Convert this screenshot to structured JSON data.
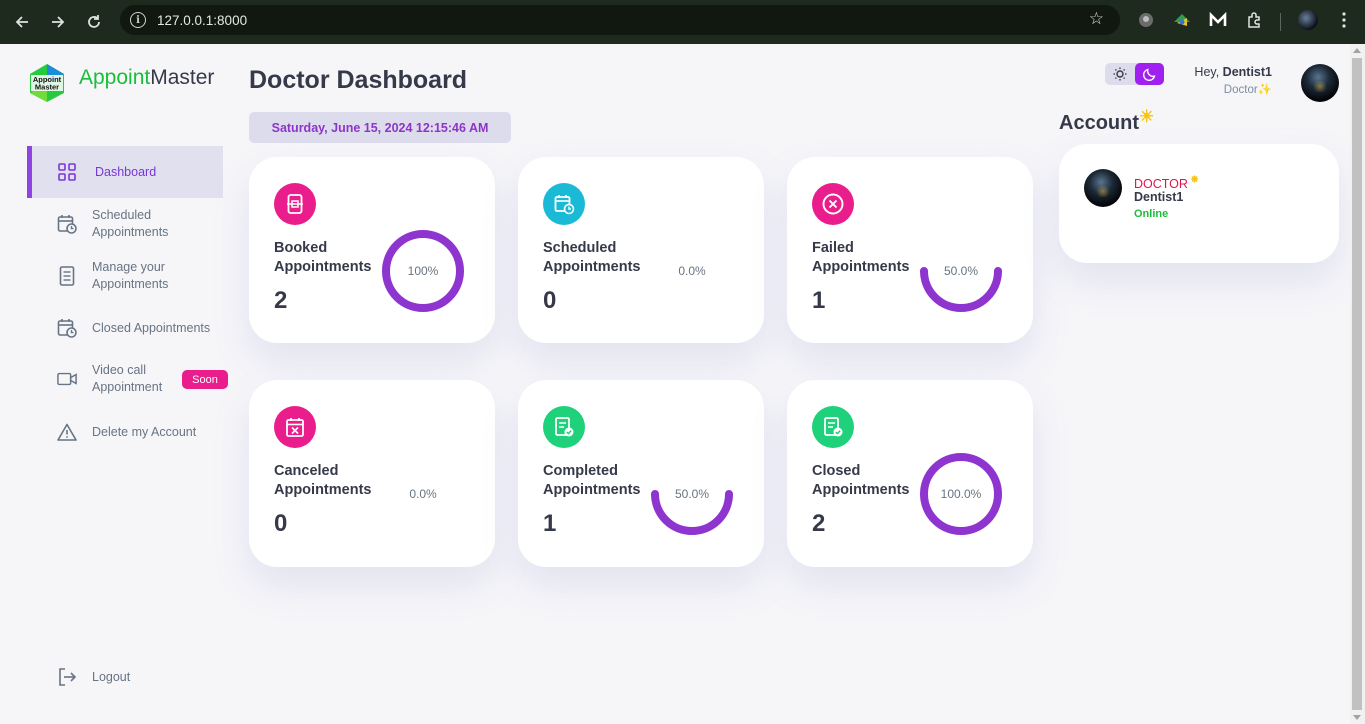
{
  "browser": {
    "url": "127.0.0.1:8000",
    "icons": [
      "back-icon",
      "forward-icon",
      "reload-icon",
      "site-info-icon",
      "bookmark-star-icon",
      "extension-icon",
      "extensions-puzzle-icon",
      "menu-icon"
    ]
  },
  "brand": {
    "part1": "Appoint",
    "part2": "Master",
    "logo_text": "Appoint Master"
  },
  "sidebar": {
    "items": [
      {
        "label": "Dashboard",
        "icon": "grid-icon",
        "active": true
      },
      {
        "label": "Scheduled\nAppointments",
        "icon": "calendar-clock-icon"
      },
      {
        "label": "Manage your\nAppointments",
        "icon": "document-icon"
      },
      {
        "label": "Closed Appointments",
        "icon": "calendar-clock-icon"
      },
      {
        "label": "Video call\nAppointment",
        "icon": "video-icon",
        "badge": "Soon"
      },
      {
        "label": "Delete my Account",
        "icon": "warning-icon"
      }
    ],
    "logout": "Logout"
  },
  "main": {
    "title": "Doctor Dashboard",
    "datetime": "Saturday, June 15, 2024 12:15:46 AM",
    "cards": [
      {
        "title": "Booked\nAppointments",
        "value": "2",
        "percent_label": "100%",
        "percent": 100,
        "color": "#e91e8c",
        "icon": "booked-icon"
      },
      {
        "title": "Scheduled\nAppointments",
        "value": "0",
        "percent_label": "0.0%",
        "percent": 0,
        "color": "#1ab9d6",
        "icon": "calendar-clock-icon"
      },
      {
        "title": "Failed\nAppointments",
        "value": "1",
        "percent_label": "50.0%",
        "percent": 50,
        "color": "#e91e8c",
        "icon": "x-circle-icon"
      },
      {
        "title": "Canceled\nAppointments",
        "value": "0",
        "percent_label": "0.0%",
        "percent": 0,
        "color": "#e91e8c",
        "icon": "calendar-x-icon"
      },
      {
        "title": "Completed\nAppointments",
        "value": "1",
        "percent_label": "50.0%",
        "percent": 50,
        "color": "#1fd17a",
        "icon": "document-check-icon"
      },
      {
        "title": "Closed\nAppointments",
        "value": "2",
        "percent_label": "100.0%",
        "percent": 100,
        "color": "#1fd17a",
        "icon": "document-check-icon"
      }
    ],
    "ring_color": "#8e35d0"
  },
  "header": {
    "greeting": "Hey, ",
    "username": "Dentist1",
    "role": "Doctor",
    "role_emoji": "✨"
  },
  "account": {
    "title": "Account",
    "title_emoji": "☀",
    "role": "DOCTOR",
    "role_emoji": "✸",
    "name": "Dentist1",
    "status": "Online"
  },
  "colors": {
    "accent": "#8e44e0",
    "brand_green": "#1bbd3a",
    "online": "#1bbd3a",
    "role_red": "#e0144f"
  }
}
